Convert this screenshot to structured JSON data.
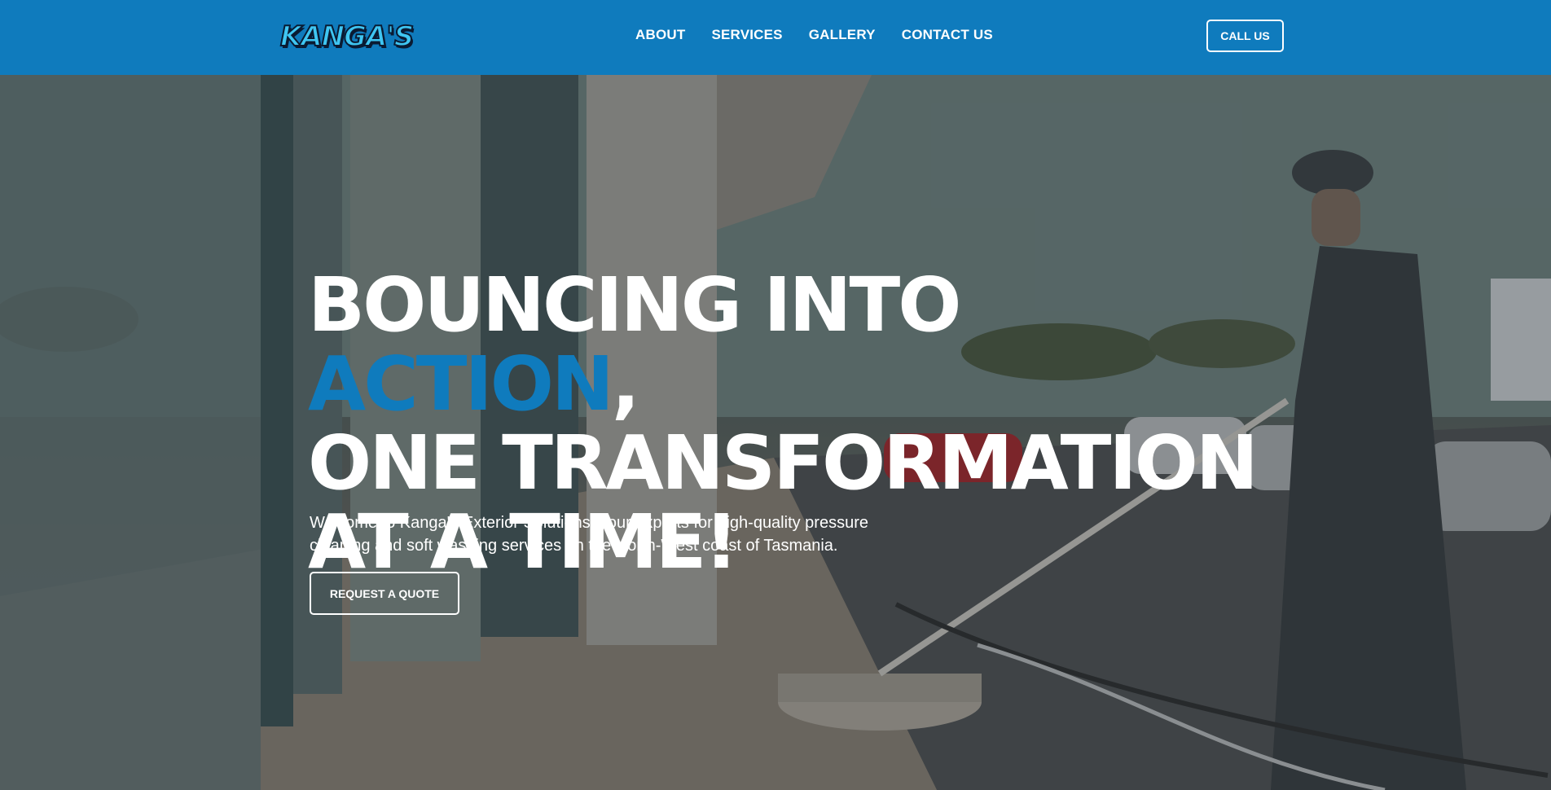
{
  "header": {
    "logo_text": "KANGA'S",
    "nav": [
      {
        "label": "ABOUT"
      },
      {
        "label": "SERVICES"
      },
      {
        "label": "GALLERY"
      },
      {
        "label": "CONTACT US"
      }
    ],
    "call_label": "CALL US",
    "background_color": "#0f7bbd"
  },
  "hero": {
    "headline_part1": "BOUNCING INTO ",
    "headline_accent": "ACTION",
    "headline_part2": ",",
    "headline_line2": "ONE TRANSFORMATION",
    "headline_line3": "AT A TIME!",
    "subtitle": "Welcome to Kanga's Exterior Solutions, your experts for high-quality pressure cleaning and soft washing services on the North-West coast of Tasmania.",
    "cta_label": "REQUEST A QUOTE",
    "accent_color": "#0f7bbd",
    "background_image": "photo-of-worker-pressure-cleaning-pavement"
  }
}
